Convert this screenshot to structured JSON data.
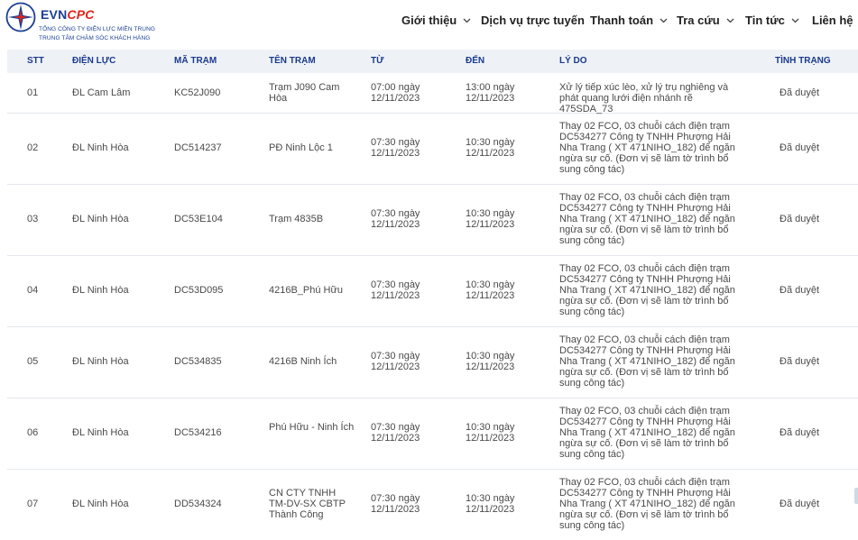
{
  "logo": {
    "brand_evn": "EVN",
    "brand_cpc": "CPC",
    "line1": "TỔNG CÔNG TY ĐIỆN LỰC MIỀN TRUNG",
    "line2": "TRUNG TÂM CHĂM SÓC KHÁCH HÀNG"
  },
  "nav": {
    "items": [
      {
        "label": "Giới thiệu",
        "has_dropdown": true
      },
      {
        "label": "Dịch vụ trực tuyến",
        "has_dropdown": false
      },
      {
        "label": "Thanh toán",
        "has_dropdown": true
      },
      {
        "label": "Tra cứu",
        "has_dropdown": true
      },
      {
        "label": "Tin tức",
        "has_dropdown": true
      },
      {
        "label": "Liên hệ",
        "has_dropdown": false
      }
    ]
  },
  "table": {
    "headers": [
      "STT",
      "Điện lực",
      "Mã trạm",
      "Tên trạm",
      "Từ",
      "Đến",
      "Lý do",
      "Tình trạng"
    ],
    "rows": [
      {
        "stt": "01",
        "dien_luc": "ĐL Cam Lâm",
        "ma_tram": "KC52J090",
        "ten_tram": "Trạm J090 Cam Hòa",
        "tu": "07:00 ngày 12/11/2023",
        "den": "13:00 ngày 12/11/2023",
        "ly_do": "Xử lý tiếp xúc lèo, xử lý trụ nghiêng và phát quang lưới điện nhánh rẽ 475SDA_73",
        "tinh_trang": "Đã duyệt"
      },
      {
        "stt": "02",
        "dien_luc": "ĐL Ninh Hòa",
        "ma_tram": "DC514237",
        "ten_tram": "PĐ Ninh Lộc 1",
        "tu": "07:30 ngày 12/11/2023",
        "den": "10:30 ngày 12/11/2023",
        "ly_do": "Thay 02 FCO, 03 chuỗi cách điện trạm DC534277 Công ty TNHH Phượng Hải Nha Trang ( XT 471NIHO_182) để ngăn ngừa sự cố. (Đơn vị sẽ làm tờ trình bổ sung công tác)",
        "tinh_trang": "Đã duyệt"
      },
      {
        "stt": "03",
        "dien_luc": "ĐL Ninh Hòa",
        "ma_tram": "DC53E104",
        "ten_tram": "Trạm 4835B",
        "tu": "07:30 ngày 12/11/2023",
        "den": "10:30 ngày 12/11/2023",
        "ly_do": "Thay 02 FCO, 03 chuỗi cách điện trạm DC534277 Công ty TNHH Phượng Hải Nha Trang ( XT 471NIHO_182) để ngăn ngừa sự cố. (Đơn vị sẽ làm tờ trình bổ sung công tác)",
        "tinh_trang": "Đã duyệt"
      },
      {
        "stt": "04",
        "dien_luc": "ĐL Ninh Hòa",
        "ma_tram": "DC53D095",
        "ten_tram": "4216B_Phú Hữu",
        "tu": "07:30 ngày 12/11/2023",
        "den": "10:30 ngày 12/11/2023",
        "ly_do": "Thay 02 FCO, 03 chuỗi cách điện trạm DC534277 Công ty TNHH Phượng Hải Nha Trang ( XT 471NIHO_182) để ngăn ngừa sự cố. (Đơn vị sẽ làm tờ trình bổ sung công tác)",
        "tinh_trang": "Đã duyệt"
      },
      {
        "stt": "05",
        "dien_luc": "ĐL Ninh Hòa",
        "ma_tram": "DC534835",
        "ten_tram": "4216B Ninh Ích",
        "tu": "07:30 ngày 12/11/2023",
        "den": "10:30 ngày 12/11/2023",
        "ly_do": "Thay 02 FCO, 03 chuỗi cách điện trạm DC534277 Công ty TNHH Phượng Hải Nha Trang ( XT 471NIHO_182) để ngăn ngừa sự cố. (Đơn vị sẽ làm tờ trình bổ sung công tác)",
        "tinh_trang": "Đã duyệt"
      },
      {
        "stt": "06",
        "dien_luc": "ĐL Ninh Hòa",
        "ma_tram": "DC534216",
        "ten_tram": "Phú Hữu - Ninh Ích",
        "tu": "07:30 ngày 12/11/2023",
        "den": "10:30 ngày 12/11/2023",
        "ly_do": "Thay 02 FCO, 03 chuỗi cách điện trạm DC534277 Công ty TNHH Phượng Hải Nha Trang ( XT 471NIHO_182) để ngăn ngừa sự cố. (Đơn vị sẽ làm tờ trình bổ sung công tác)",
        "tinh_trang": "Đã duyệt"
      },
      {
        "stt": "07",
        "dien_luc": "ĐL Ninh Hòa",
        "ma_tram": "DD534324",
        "ten_tram": "CN CTY TNHH TM-DV-SX CBTP Thành Công",
        "tu": "07:30 ngày 12/11/2023",
        "den": "10:30 ngày 12/11/2023",
        "ly_do": "Thay 02 FCO, 03 chuỗi cách điện trạm DC534277 Công ty TNHH Phượng Hải Nha Trang ( XT 471NIHO_182) để ngăn ngừa sự cố. (Đơn vị sẽ làm tờ trình bổ sung công tác)",
        "tinh_trang": "Đã duyệt"
      }
    ]
  },
  "colors": {
    "brand_blue": "#1b3f94",
    "brand_red": "#e2231a",
    "header_bg": "#eef2f7",
    "header_text": "#1a3a8c"
  }
}
